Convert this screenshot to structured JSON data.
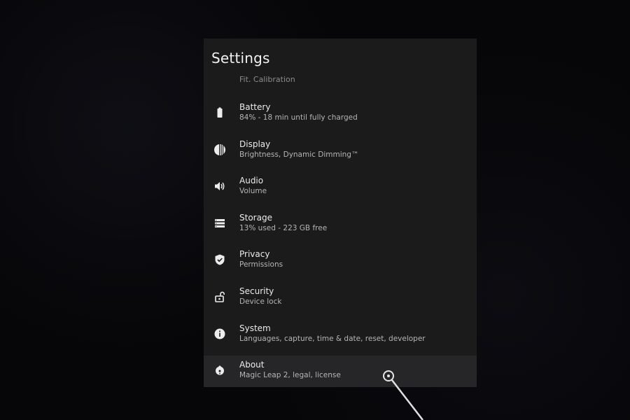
{
  "panel": {
    "title": "Settings",
    "partial_item_sub": "Fit, Calibration"
  },
  "items": [
    {
      "label": "Battery",
      "sub": "84% - 18 min until fully charged",
      "icon": "battery-icon"
    },
    {
      "label": "Display",
      "sub": "Brightness, Dynamic Dimming™",
      "icon": "display-icon"
    },
    {
      "label": "Audio",
      "sub": "Volume",
      "icon": "speaker-icon"
    },
    {
      "label": "Storage",
      "sub": "13% used - 223 GB free",
      "icon": "storage-icon"
    },
    {
      "label": "Privacy",
      "sub": "Permissions",
      "icon": "shield-icon"
    },
    {
      "label": "Security",
      "sub": "Device lock",
      "icon": "unlock-icon"
    },
    {
      "label": "System",
      "sub": "Languages, capture, time & date, reset, developer",
      "icon": "info-icon"
    },
    {
      "label": "About",
      "sub": "Magic Leap 2, legal, license",
      "icon": "device-icon"
    }
  ],
  "colors": {
    "background": "#060608",
    "panel": "#1b1b1c",
    "highlight": "#262628",
    "text_primary": "#ececec",
    "text_secondary": "#b5b5b5"
  }
}
